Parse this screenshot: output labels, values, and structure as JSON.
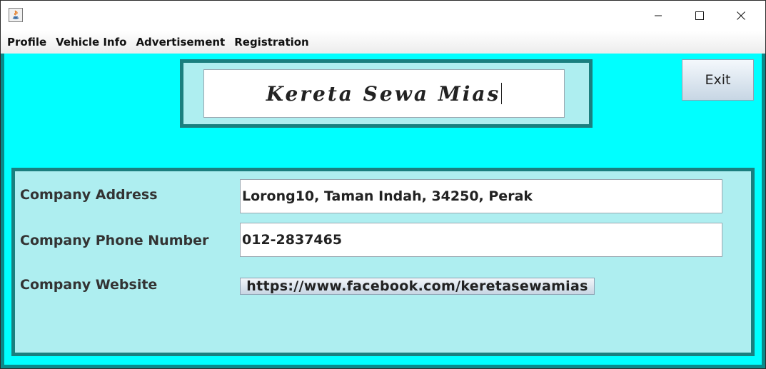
{
  "menu": [
    "Profile",
    "Vehicle Info",
    "Advertisement",
    "Registration"
  ],
  "window_controls": {
    "minimize_icon": "minimize-icon",
    "maximize_icon": "maximize-icon",
    "close_icon": "close-icon",
    "app_icon": "java-app-icon"
  },
  "header": {
    "title": "Kereta Sewa Mias",
    "exit_label": "Exit"
  },
  "company": {
    "address_label": "Company Address",
    "address_value": "Lorong10, Taman Indah, 34250, Perak",
    "phone_label": "Company Phone Number",
    "phone_value": "012-2837465",
    "website_label": "Company Website",
    "website_value": "https://www.facebook.com/keretasewamias"
  },
  "colors": {
    "background": "#00ffff",
    "panel": "#aeeef0",
    "border": "#1a7f7f"
  }
}
